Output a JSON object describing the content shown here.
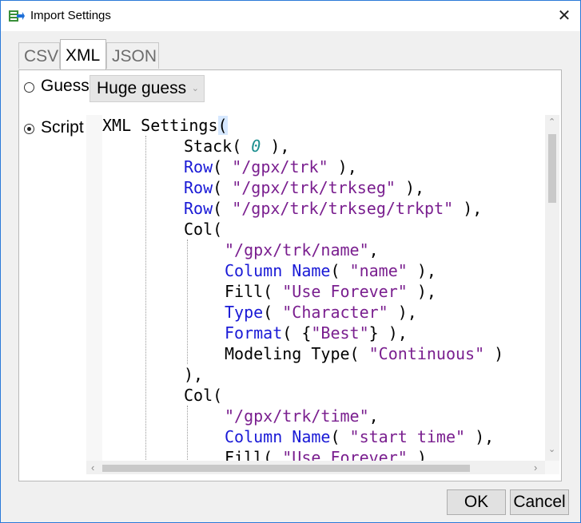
{
  "window": {
    "title": "Import Settings",
    "close_symbol": "✕"
  },
  "tabs": [
    {
      "label": "CSV",
      "active": false
    },
    {
      "label": "XML",
      "active": true
    },
    {
      "label": "JSON",
      "active": false
    }
  ],
  "options": {
    "guess": {
      "label": "Guess",
      "selected": false
    },
    "guess_combo": {
      "value": "Huge guess"
    },
    "script": {
      "label": "Script",
      "selected": true
    }
  },
  "code_lines": [
    {
      "indent": 0,
      "tokens": [
        {
          "t": "XML Settings",
          "c": "plain"
        },
        {
          "t": "(",
          "c": "hl"
        }
      ]
    },
    {
      "indent": 1,
      "tokens": [
        {
          "t": "Stack( ",
          "c": "plain"
        },
        {
          "t": "0",
          "c": "num"
        },
        {
          "t": " ),",
          "c": "plain"
        }
      ]
    },
    {
      "indent": 1,
      "tokens": [
        {
          "t": "Row",
          "c": "kw"
        },
        {
          "t": "( ",
          "c": "plain"
        },
        {
          "t": "\"/gpx/trk\"",
          "c": "str"
        },
        {
          "t": " ),",
          "c": "plain"
        }
      ]
    },
    {
      "indent": 1,
      "tokens": [
        {
          "t": "Row",
          "c": "kw"
        },
        {
          "t": "( ",
          "c": "plain"
        },
        {
          "t": "\"/gpx/trk/trkseg\"",
          "c": "str"
        },
        {
          "t": " ),",
          "c": "plain"
        }
      ]
    },
    {
      "indent": 1,
      "tokens": [
        {
          "t": "Row",
          "c": "kw"
        },
        {
          "t": "( ",
          "c": "plain"
        },
        {
          "t": "\"/gpx/trk/trkseg/trkpt\"",
          "c": "str"
        },
        {
          "t": " ),",
          "c": "plain"
        }
      ]
    },
    {
      "indent": 1,
      "tokens": [
        {
          "t": "Col(",
          "c": "plain"
        }
      ]
    },
    {
      "indent": 2,
      "tokens": [
        {
          "t": "\"/gpx/trk/name\"",
          "c": "str"
        },
        {
          "t": ",",
          "c": "plain"
        }
      ]
    },
    {
      "indent": 2,
      "tokens": [
        {
          "t": "Column Name",
          "c": "kw"
        },
        {
          "t": "( ",
          "c": "plain"
        },
        {
          "t": "\"name\"",
          "c": "str"
        },
        {
          "t": " ),",
          "c": "plain"
        }
      ]
    },
    {
      "indent": 2,
      "tokens": [
        {
          "t": "Fill( ",
          "c": "plain"
        },
        {
          "t": "\"Use Forever\"",
          "c": "str"
        },
        {
          "t": " ),",
          "c": "plain"
        }
      ]
    },
    {
      "indent": 2,
      "tokens": [
        {
          "t": "Type",
          "c": "kw"
        },
        {
          "t": "( ",
          "c": "plain"
        },
        {
          "t": "\"Character\"",
          "c": "str"
        },
        {
          "t": " ),",
          "c": "plain"
        }
      ]
    },
    {
      "indent": 2,
      "tokens": [
        {
          "t": "Format",
          "c": "kw"
        },
        {
          "t": "( {",
          "c": "plain"
        },
        {
          "t": "\"Best\"",
          "c": "str"
        },
        {
          "t": "} ),",
          "c": "plain"
        }
      ]
    },
    {
      "indent": 2,
      "tokens": [
        {
          "t": "Modeling Type( ",
          "c": "plain"
        },
        {
          "t": "\"Continuous\"",
          "c": "str"
        },
        {
          "t": " )",
          "c": "plain"
        }
      ]
    },
    {
      "indent": 1,
      "tokens": [
        {
          "t": "),",
          "c": "plain"
        }
      ]
    },
    {
      "indent": 1,
      "tokens": [
        {
          "t": "Col(",
          "c": "plain"
        }
      ]
    },
    {
      "indent": 2,
      "tokens": [
        {
          "t": "\"/gpx/trk/time\"",
          "c": "str"
        },
        {
          "t": ",",
          "c": "plain"
        }
      ]
    },
    {
      "indent": 2,
      "tokens": [
        {
          "t": "Column Name",
          "c": "kw"
        },
        {
          "t": "( ",
          "c": "plain"
        },
        {
          "t": "\"start time\"",
          "c": "str"
        },
        {
          "t": " ),",
          "c": "plain"
        }
      ]
    },
    {
      "indent": 2,
      "tokens": [
        {
          "t": "Fill( ",
          "c": "plain"
        },
        {
          "t": "\"Use Forever\"",
          "c": "str"
        },
        {
          "t": " )",
          "c": "plain"
        }
      ]
    }
  ],
  "buttons": {
    "ok": "OK",
    "cancel": "Cancel"
  },
  "colors": {
    "keyword": "#1a1ad6",
    "string": "#7a1f8f",
    "number": "#1b8f8f",
    "window_border": "#2b79d8"
  }
}
